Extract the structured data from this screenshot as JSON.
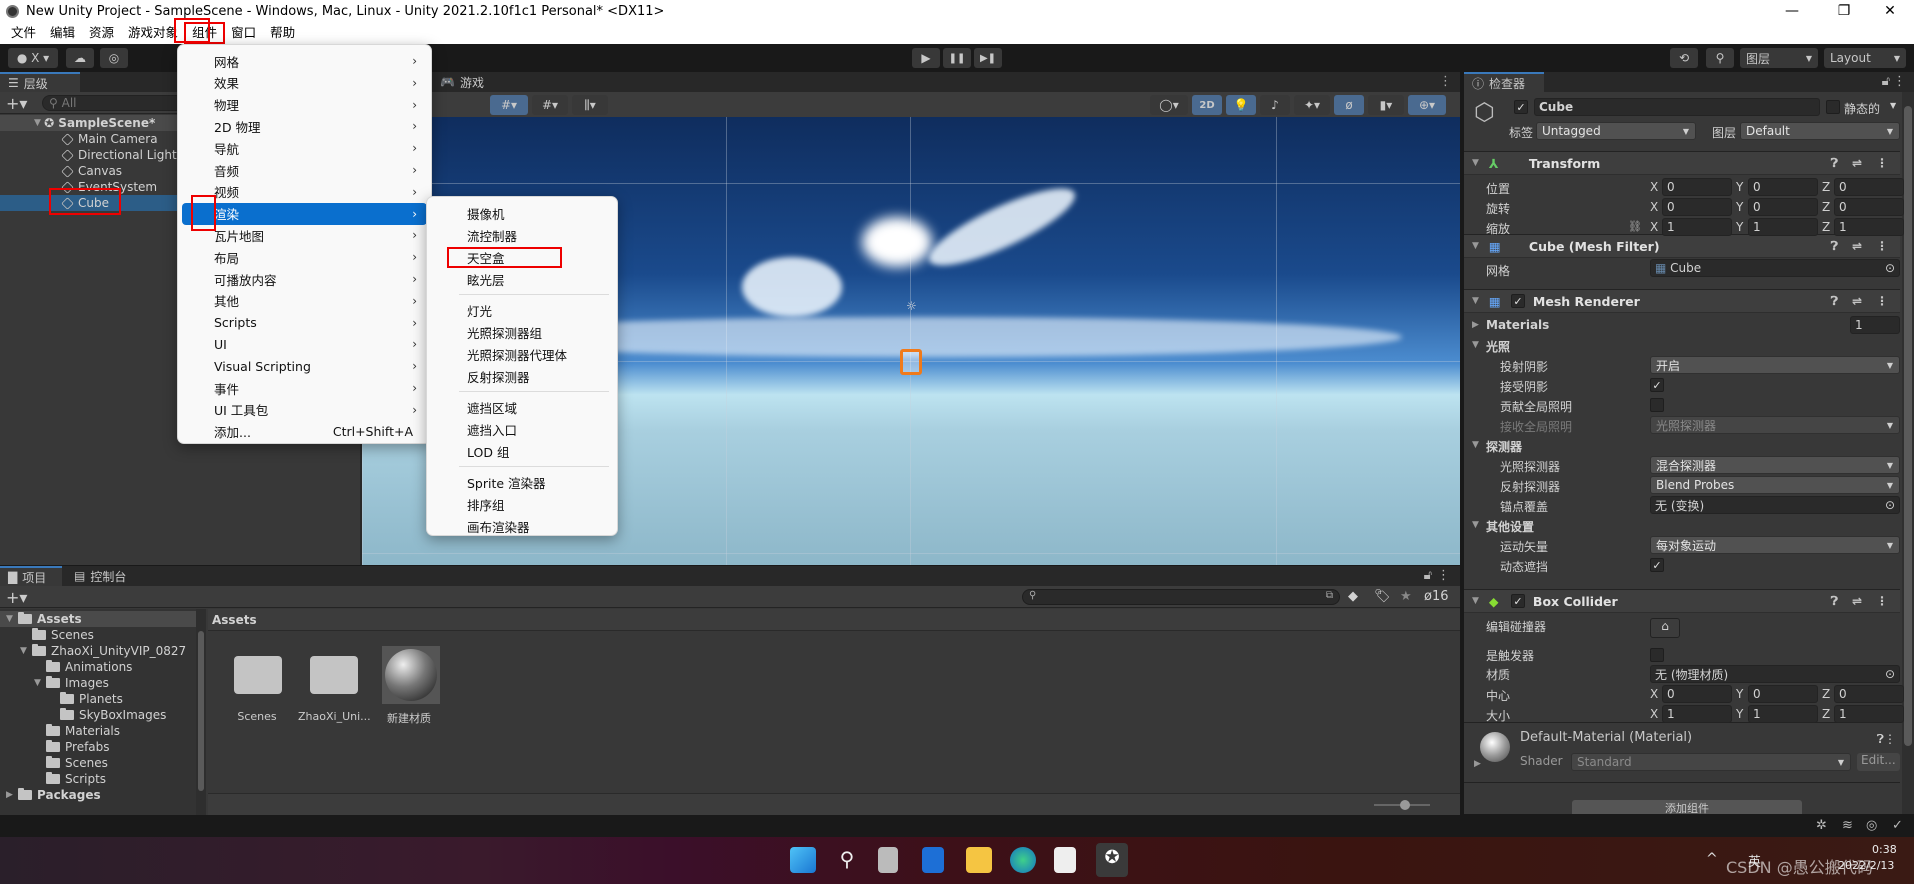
{
  "window": {
    "title": "New Unity Project - SampleScene - Windows, Mac, Linux - Unity 2021.2.10f1c1 Personal* <DX11>",
    "minimize": "—",
    "maximize": "❐",
    "close": "✕"
  },
  "menubar": [
    "文件",
    "编辑",
    "资源",
    "游戏对象",
    "组件",
    "窗口",
    "帮助"
  ],
  "menubar_active": "组件",
  "toolbar": {
    "account": "X",
    "play": "▶",
    "pause": "❚❚",
    "step": "▶❚",
    "layers": "图层",
    "layout": "Layout"
  },
  "hierarchy": {
    "tab": "层级",
    "search_placeholder": "All",
    "scene": "SampleScene*",
    "items": [
      "Main Camera",
      "Directional Light",
      "Canvas",
      "EventSystem",
      "Cube"
    ],
    "selected": "Cube"
  },
  "game_tab": "游戏",
  "component_menu": {
    "items": [
      {
        "label": "网格",
        "submenu": true
      },
      {
        "label": "效果",
        "submenu": true
      },
      {
        "label": "物理",
        "submenu": true
      },
      {
        "label": "2D 物理",
        "submenu": true
      },
      {
        "label": "导航",
        "submenu": true
      },
      {
        "label": "音频",
        "submenu": true
      },
      {
        "label": "视频",
        "submenu": true
      },
      {
        "label": "渲染",
        "submenu": true,
        "selected": true
      },
      {
        "label": "瓦片地图",
        "submenu": true
      },
      {
        "label": "布局",
        "submenu": true
      },
      {
        "label": "可播放内容",
        "submenu": true
      },
      {
        "label": "其他",
        "submenu": true
      },
      {
        "label": "Scripts",
        "submenu": true
      },
      {
        "label": "UI",
        "submenu": true
      },
      {
        "label": "Visual Scripting",
        "submenu": true
      },
      {
        "label": "事件",
        "submenu": true
      },
      {
        "label": "UI 工具包",
        "submenu": true
      },
      {
        "label": "添加...",
        "shortcut": "Ctrl+Shift+A"
      }
    ]
  },
  "render_submenu": {
    "groups": [
      [
        "摄像机",
        "流控制器",
        "天空盒",
        "眩光层"
      ],
      [
        "灯光",
        "光照探测器组",
        "光照探测器代理体",
        "反射探测器"
      ],
      [
        "遮挡区域",
        "遮挡入口",
        "LOD 组"
      ],
      [
        "Sprite 渲染器",
        "排序组",
        "画布渲染器"
      ]
    ],
    "highlighted": "天空盒"
  },
  "scene_toolbar": {
    "mode_2d": "2D"
  },
  "inspector": {
    "tab": "检查器",
    "object_name": "Cube",
    "static_label": "静态的",
    "tag_label": "标签",
    "tag_value": "Untagged",
    "layer_label": "图层",
    "layer_value": "Default",
    "transform": {
      "title": "Transform",
      "rows": [
        {
          "label": "位置",
          "x": "0",
          "y": "0",
          "z": "0"
        },
        {
          "label": "旋转",
          "x": "0",
          "y": "0",
          "z": "0"
        },
        {
          "label": "缩放",
          "x": "1",
          "y": "1",
          "z": "1"
        }
      ]
    },
    "mesh_filter": {
      "title": "Cube (Mesh Filter)",
      "mesh_label": "网格",
      "mesh_value": "Cube"
    },
    "mesh_renderer": {
      "title": "Mesh Renderer",
      "materials_label": "Materials",
      "materials_count": "1",
      "lighting_label": "光照",
      "cast_shadows_label": "投射阴影",
      "cast_shadows_value": "开启",
      "receive_shadows_label": "接受阴影",
      "receive_shadows": true,
      "contribute_gi_label": "贡献全局照明",
      "contribute_gi": false,
      "receive_gi_label": "接收全局照明",
      "receive_gi_value": "光照探测器",
      "probes_label": "探测器",
      "light_probes_label": "光照探测器",
      "light_probes_value": "混合探测器",
      "reflection_probes_label": "反射探测器",
      "reflection_probes_value": "Blend Probes",
      "anchor_label": "锚点覆盖",
      "anchor_value": "无 (变换)",
      "other_label": "其他设置",
      "motion_vectors_label": "运动矢量",
      "motion_vectors_value": "每对象运动",
      "dynamic_occlusion_label": "动态遮挡",
      "dynamic_occlusion": true
    },
    "box_collider": {
      "title": "Box Collider",
      "edit_label": "编辑碰撞器",
      "trigger_label": "是触发器",
      "material_label": "材质",
      "material_value": "无 (物理材质)",
      "center_label": "中心",
      "center": {
        "x": "0",
        "y": "0",
        "z": "0"
      },
      "size_label": "大小",
      "size": {
        "x": "1",
        "y": "1",
        "z": "1"
      }
    },
    "material": {
      "title": "Default-Material (Material)",
      "shader_label": "Shader",
      "shader_value": "Standard",
      "edit_button": "Edit..."
    },
    "add_component": "添加组件"
  },
  "project": {
    "tab_project": "项目",
    "tab_console": "控制台",
    "hidden_count": "16",
    "breadcrumb": "Assets",
    "tree": [
      {
        "label": "Assets",
        "depth": 0,
        "bold": true,
        "open": true
      },
      {
        "label": "Scenes",
        "depth": 1
      },
      {
        "label": "ZhaoXi_UnityVIP_0827",
        "depth": 1,
        "open": true
      },
      {
        "label": "Animations",
        "depth": 2
      },
      {
        "label": "Images",
        "depth": 2,
        "open": true
      },
      {
        "label": "Planets",
        "depth": 3
      },
      {
        "label": "SkyBoxImages",
        "depth": 3
      },
      {
        "label": "Materials",
        "depth": 2
      },
      {
        "label": "Prefabs",
        "depth": 2
      },
      {
        "label": "Scenes",
        "depth": 2
      },
      {
        "label": "Scripts",
        "depth": 2
      },
      {
        "label": "Packages",
        "depth": 0,
        "bold": true,
        "closed": true
      }
    ],
    "assets": [
      {
        "label": "Scenes",
        "type": "folder"
      },
      {
        "label": "ZhaoXi_Uni...",
        "type": "folder"
      },
      {
        "label": "新建材质",
        "type": "material"
      }
    ]
  },
  "taskbar": {
    "time": "0:38",
    "date": "2022/2/13",
    "ime": "英",
    "watermark": "CSDN @愚公搬代码"
  }
}
